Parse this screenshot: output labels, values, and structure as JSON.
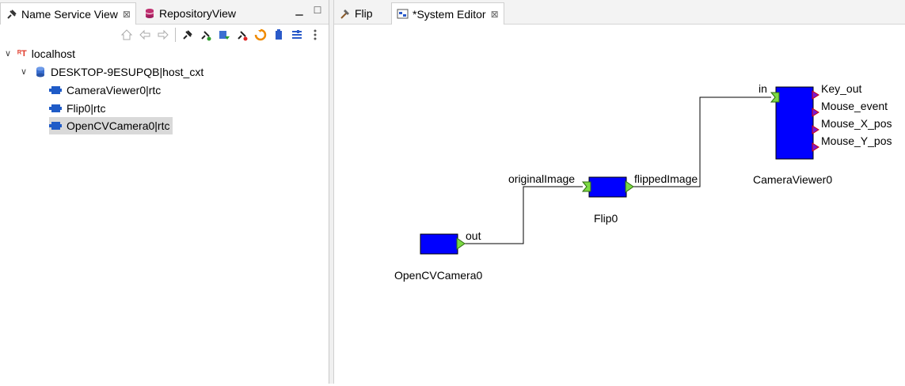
{
  "left_tabs": [
    {
      "label": "Name Service View",
      "icon": "plug-icon",
      "active": true
    },
    {
      "label": "RepositoryView",
      "icon": "database-icon",
      "active": false
    }
  ],
  "tree": {
    "root": {
      "label": "localhost",
      "icon": "rt-icon",
      "expanded": true
    },
    "host": {
      "label": "DESKTOP-9ESUPQB|host_cxt",
      "icon": "cylinder-icon",
      "expanded": true
    },
    "components": [
      {
        "label": "CameraViewer0|rtc",
        "icon": "component-icon",
        "selected": false
      },
      {
        "label": "Flip0|rtc",
        "icon": "component-icon",
        "selected": false
      },
      {
        "label": "OpenCVCamera0|rtc",
        "icon": "component-icon",
        "selected": true
      }
    ]
  },
  "editor_tabs": [
    {
      "label": "Flip",
      "icon": "hammer-icon",
      "active": false
    },
    {
      "label": "*System Editor",
      "icon": "system-editor-icon",
      "active": true
    }
  ],
  "diagram": {
    "components": [
      {
        "name": "OpenCVCamera0",
        "outports": [
          "out"
        ],
        "inports": []
      },
      {
        "name": "Flip0",
        "inports": [
          "originalImage"
        ],
        "outports": [
          "flippedImage"
        ]
      },
      {
        "name": "CameraViewer0",
        "inports": [
          "in"
        ],
        "outports": [
          "Key_out",
          "Mouse_event",
          "Mouse_X_pos",
          "Mouse_Y_pos"
        ]
      }
    ],
    "connections": [
      {
        "from": "OpenCVCamera0.out",
        "to": "Flip0.originalImage"
      },
      {
        "from": "Flip0.flippedImage",
        "to": "CameraViewer0.in"
      }
    ],
    "colors": {
      "component_fill": "#0000ff",
      "inport": "#7cd944",
      "outport": "#7cd944",
      "service_port": "#d00000",
      "wire": "#000000"
    }
  }
}
